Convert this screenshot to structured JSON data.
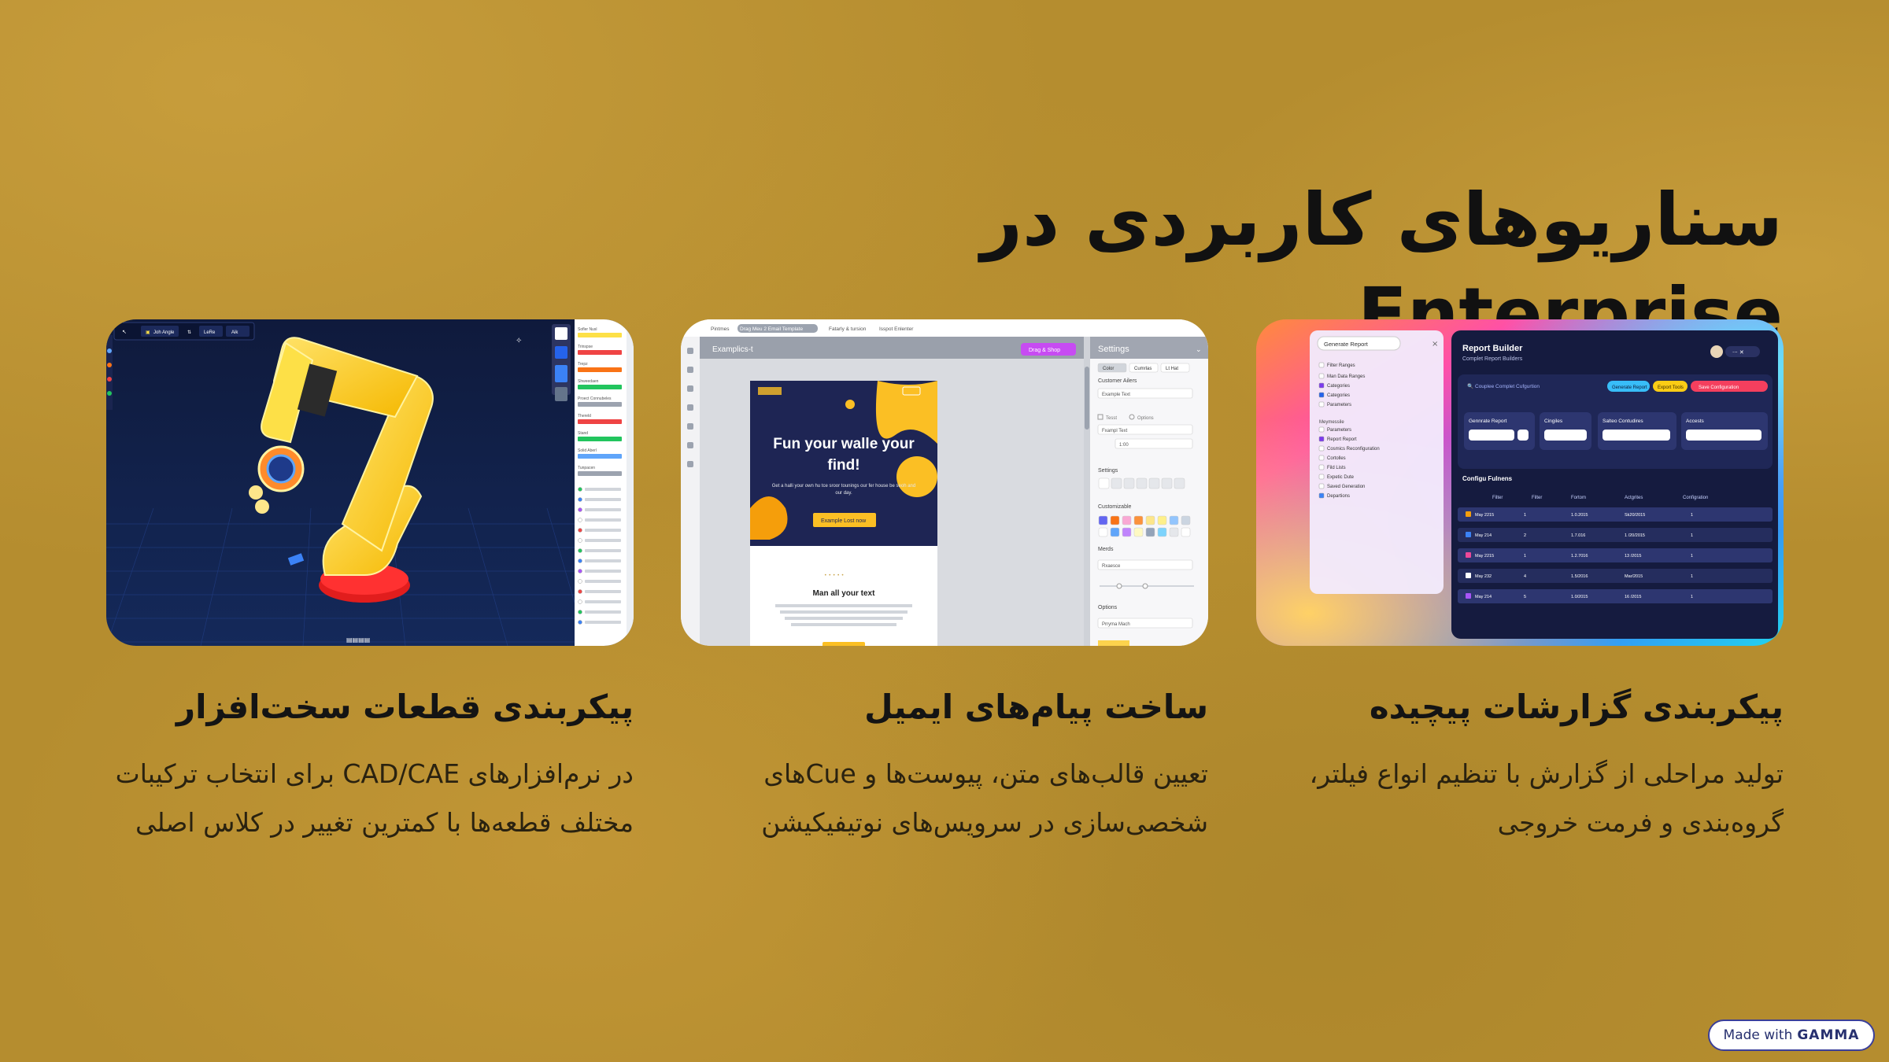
{
  "title": "سناریوهای کاربردی در Enterprise",
  "cards": [
    {
      "title": "پیکربندی گزارشات پیچیده",
      "description": "تولید مراحلی از گزارش با تنظیم انواع فیلتر، گروه‌بندی و فرمت خروجی",
      "ui": {
        "panel_title": "Report Builder",
        "panel_subtitle": "Complet Report Builders",
        "left_menu_button": "Generate Report",
        "left_items": [
          "Filter Ranges",
          "Man Data Ranges",
          "Categories",
          "Categories",
          "Parameters",
          "Parameters",
          "Report Report",
          "Cosmics Reconfiguration",
          "Cortolles",
          "Fild Lists",
          "Expetic Dute",
          "Saved Generation",
          "Departions"
        ],
        "actions": [
          "Generate Report",
          "Export Tools",
          "Save Configuration"
        ],
        "section": "Configu Fulnens",
        "columns": [
          "Filter",
          "Filter",
          "Fortom",
          "Actgrites",
          "Configration"
        ],
        "rows": [
          [
            "May 2215",
            "1",
            "1.0.2015",
            "Sk20/2015",
            "1"
          ],
          [
            "May 214",
            "2",
            "1.7.016",
            "1 /20/2015",
            "1"
          ],
          [
            "May 2215",
            "1",
            "1.2.7016",
            "13 /2015",
            "1"
          ],
          [
            "May 232",
            "4",
            "1.5/2016",
            "Mar/2015",
            "1"
          ],
          [
            "May 214",
            "5",
            "1.0/2015",
            "16 /2015",
            "1"
          ]
        ]
      }
    },
    {
      "title": "ساخت پیام‌های ایمیل",
      "description": "تعیین قالب‌های متن، پیوست‌ها و Cueهای شخصی‌سازی در سرویس‌های نوتیفیکیشن",
      "ui": {
        "tabs": [
          "Pintmes",
          "Drag Meu 2 Email Template",
          "Fatarly & tursion",
          "Isspot Enlenter"
        ],
        "doc_title": "Examplics-t",
        "drag_button": "Drag & Shop",
        "settings_title": "Settings",
        "hero_text": "Fun your walle your find!",
        "hero_body": "Get a halli your own hu tce sroor tounings our fer house be seoh and our day.",
        "hero_button": "Example Lost now",
        "lower_heading": "Man all your text",
        "setting_tabs": [
          "Color",
          "Cumrlas",
          "Lt Hat"
        ],
        "setting_labels": [
          "Customer Ailers",
          "Settings",
          "Customizable",
          "Merds",
          "Options"
        ],
        "field_values": [
          "Example Text",
          "Fxampl Text",
          "1:00",
          "Rxaesce",
          "Prryma Mach"
        ],
        "check_labels": [
          "Tesst",
          "Options"
        ]
      }
    },
    {
      "title": "پیکربندی قطعات سخت‌افزار",
      "description": "در نرم‌افزارهای CAD/CAE برای انتخاب ترکیبات مختلف قطعه‌ها با کمترین تغییر در کلاس اصلی",
      "ui": {
        "toolbar_labels": [
          "Joh Angle",
          "LeRe",
          "Aik"
        ],
        "panel_labels": [
          "Sofler Nusl",
          "Trinspse",
          "Trepz",
          "Shweedaen",
          "Proect Connubeles",
          "Thereld",
          "Stand",
          "Solid Aberl",
          "Tunpacen"
        ]
      }
    }
  ],
  "badge": {
    "prefix": "Made with",
    "brand": "GAMMA"
  }
}
